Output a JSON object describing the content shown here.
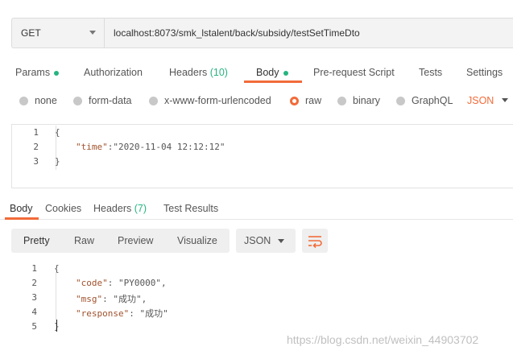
{
  "request": {
    "method": "GET",
    "url": "localhost:8073/smk_lstalent/back/subsidy/testSetTimeDto"
  },
  "request_tabs": [
    {
      "label": "Params"
    },
    {
      "label": "Authorization"
    },
    {
      "label": "Headers",
      "count": "(10)"
    },
    {
      "label": "Body"
    },
    {
      "label": "Pre-request Script"
    },
    {
      "label": "Tests"
    },
    {
      "label": "Settings"
    }
  ],
  "body_types": [
    "none",
    "form-data",
    "x-www-form-urlencoded",
    "raw",
    "binary",
    "GraphQL"
  ],
  "body_format": "JSON",
  "request_body": {
    "line_numbers": [
      "1",
      "2",
      "3"
    ],
    "lines": [
      "{",
      "\"time\"",
      ":",
      "\"2020-11-04 12:12:12\"",
      "}"
    ]
  },
  "response_tabs": [
    {
      "label": "Body"
    },
    {
      "label": "Cookies"
    },
    {
      "label": "Headers",
      "count": "(7)"
    },
    {
      "label": "Test Results"
    }
  ],
  "view_modes": [
    "Pretty",
    "Raw",
    "Preview",
    "Visualize"
  ],
  "response_format": "JSON",
  "response_body": {
    "line_numbers": [
      "1",
      "2",
      "3",
      "4",
      "5"
    ],
    "open": "{",
    "close": "}",
    "entries": [
      {
        "key": "\"code\"",
        "sep": ": ",
        "value": "\"PY0000\"",
        "trail": ","
      },
      {
        "key": "\"msg\"",
        "sep": ": ",
        "value": "\"成功\"",
        "trail": ","
      },
      {
        "key": "\"response\"",
        "sep": ": ",
        "value": "\"成功\"",
        "trail": ""
      }
    ]
  },
  "watermark": "https://blog.csdn.net/weixin_44903702",
  "colors": {
    "accent": "#f26b3a",
    "green": "#26b47f"
  }
}
